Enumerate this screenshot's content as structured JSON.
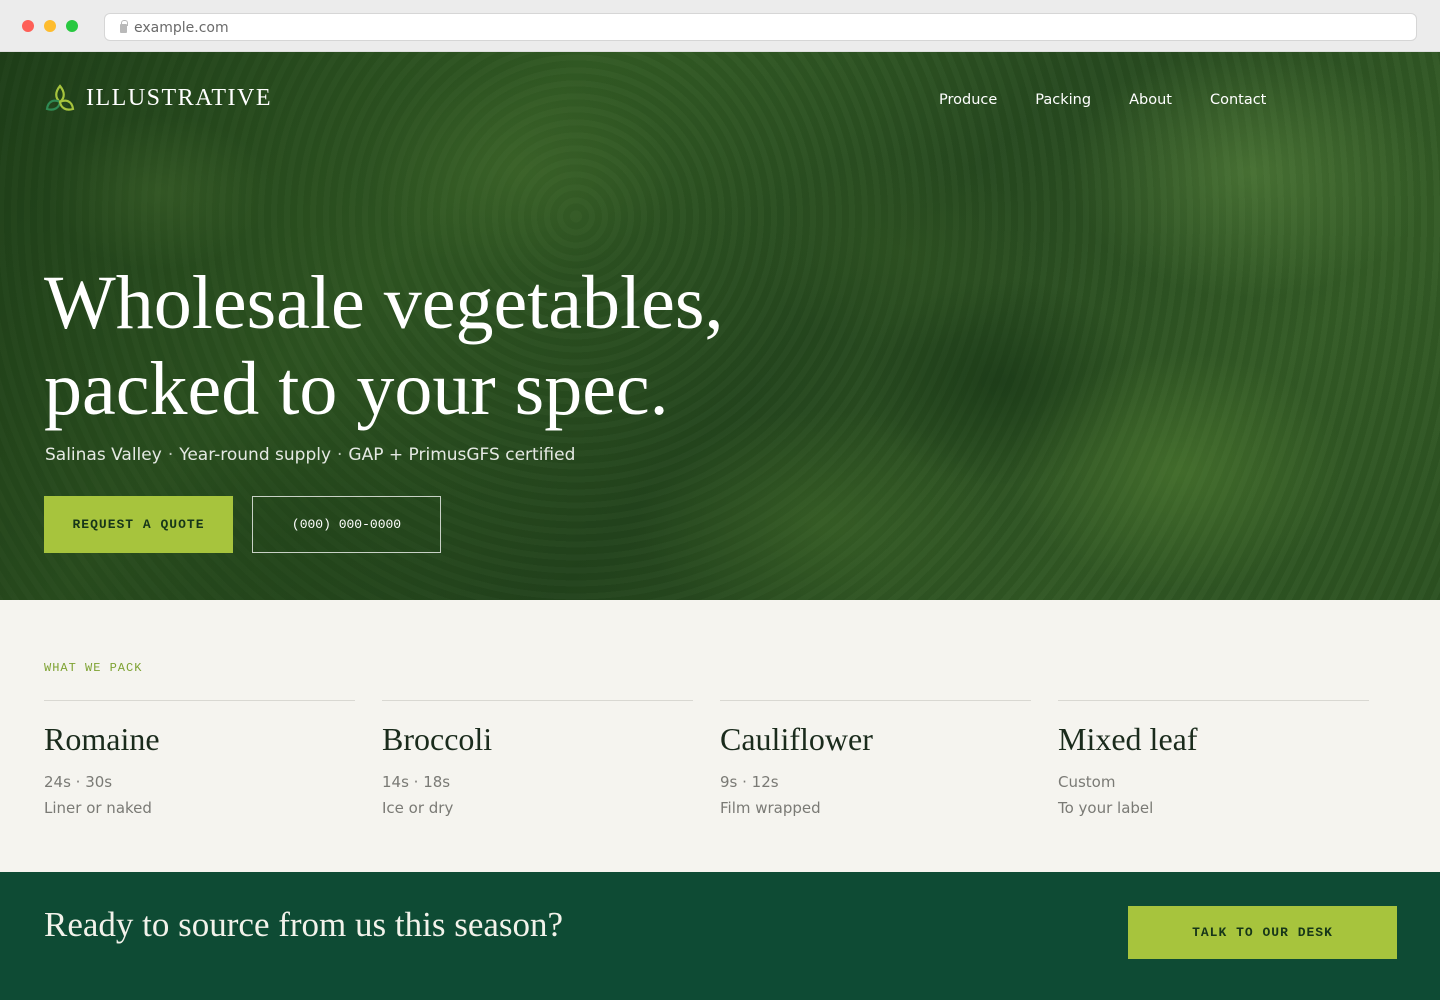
{
  "browser": {
    "url": "example.com"
  },
  "header": {
    "logo_text": "ILLUSTRATIVE",
    "nav": [
      {
        "label": "Produce"
      },
      {
        "label": "Packing"
      },
      {
        "label": "About"
      },
      {
        "label": "Contact"
      }
    ]
  },
  "hero": {
    "title_line1": "Wholesale vegetables,",
    "title_line2": "packed to your spec.",
    "sub_items": [
      "Salinas Valley",
      "Year-round supply",
      "GAP + PrimusGFS certified"
    ],
    "separator": "·",
    "cta_primary": "REQUEST A QUOTE",
    "cta_secondary": "(000) 000-0000"
  },
  "products": {
    "eyebrow": "WHAT WE PACK",
    "items": [
      {
        "name": "Romaine",
        "line1": "24s · 30s",
        "line2": "Liner or naked"
      },
      {
        "name": "Broccoli",
        "line1": "14s · 18s",
        "line2": "Ice or dry"
      },
      {
        "name": "Cauliflower",
        "line1": "9s · 12s",
        "line2": "Film wrapped"
      },
      {
        "name": "Mixed leaf",
        "line1": "Custom",
        "line2": "To your label"
      }
    ]
  },
  "cta_band": {
    "text": "Ready to source from us this season?",
    "button": "TALK TO OUR DESK"
  },
  "colors": {
    "accent": "#a7c43d",
    "dark_green": "#0e4b34",
    "page_bg": "#f5f4ef"
  },
  "icons": {
    "logo": "leaf-trefoil-icon",
    "lock": "lock-icon"
  }
}
